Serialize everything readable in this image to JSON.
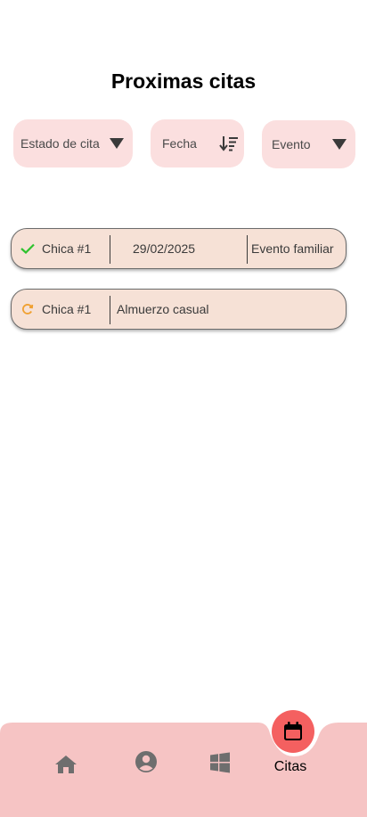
{
  "title": "Proximas citas",
  "filters": {
    "estado": {
      "label": "Estado de cita",
      "icon": "caret-down-icon"
    },
    "fecha": {
      "label": "Fecha",
      "icon": "sort-descending-icon"
    },
    "evento": {
      "label": "Evento",
      "icon": "caret-down-icon"
    }
  },
  "citas": [
    {
      "status_icon": "check-icon",
      "status_color": "#2ec22e",
      "name": "Chica #1",
      "date": "29/02/2025",
      "event": "Evento familiar"
    },
    {
      "status_icon": "pending-icon",
      "status_color": "#f0a030",
      "name": "Chica #1",
      "event": "Almuerzo casual"
    }
  ],
  "nav": {
    "items": [
      {
        "icon": "home-icon"
      },
      {
        "icon": "account-icon"
      },
      {
        "icon": "windows-icon"
      },
      {
        "icon": "calendar-icon",
        "label": "Citas",
        "active": true
      }
    ],
    "background": "#f6c4c4",
    "active_color": "#f46060"
  }
}
